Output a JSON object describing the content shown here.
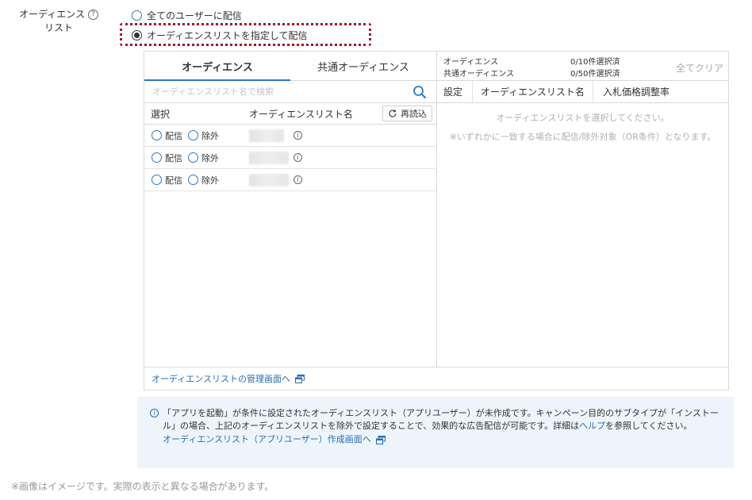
{
  "field": {
    "label_line1": "オーディエンス",
    "label_line2": "リスト",
    "help_glyph": "?"
  },
  "delivery": {
    "option_all": "全てのユーザーに配信",
    "option_list": "オーディエンスリストを指定して配信",
    "selected": "option_list"
  },
  "tabs": [
    {
      "label": "オーディエンス",
      "active": true
    },
    {
      "label": "共通オーディエンス",
      "active": false
    }
  ],
  "search": {
    "placeholder": "オーディエンスリスト名で検索"
  },
  "list_columns": {
    "select": "選択",
    "name": "オーディエンスリスト名",
    "reload": "再読込"
  },
  "list_rows": [
    {
      "deliver": "配信",
      "exclude": "除外",
      "info": "i"
    },
    {
      "deliver": "配信",
      "exclude": "除外",
      "info": "i"
    },
    {
      "deliver": "配信",
      "exclude": "除外",
      "info": "i"
    }
  ],
  "selection": {
    "audience_label": "オーディエンス",
    "audience_count": "0/10件選択済",
    "common_label": "共通オーディエンス",
    "common_count": "0/50件選択済",
    "clear_all": "全てクリア"
  },
  "selected_columns": {
    "setting": "設定",
    "name": "オーディエンスリスト名",
    "bid": "入札価格調整率"
  },
  "empty_state": {
    "line1": "オーディエンスリストを選択してください。",
    "line2": "※いずれかに一致する場合に配信/除外対象（OR条件）となります。"
  },
  "footer_link": "オーディエンスリストの管理画面へ",
  "notice": {
    "text_before": "「アプリを起動」が条件に設定されたオーディエンスリスト（アプリユーザー）が未作成です。キャンペーン目的のサブタイプが「インストール」の場合、上記のオーディエンスリストを除外で設定することで、効果的な広告配信が可能です。詳細は",
    "help_link": "ヘルプ",
    "text_after": "を参照してください。",
    "create_link": "オーディエンスリスト（アプリユーザー）作成画面へ"
  },
  "disclaimer": "※画像はイメージです。実際の表示と異なる場合があります。",
  "colors": {
    "accent": "#2a7ac2",
    "link": "#2a6fb3",
    "highlight_border": "#a2152f",
    "notice_bg": "#edf4fb"
  }
}
